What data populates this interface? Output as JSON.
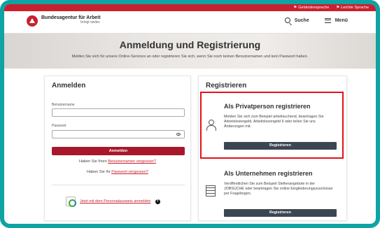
{
  "topbar": {
    "links": [
      "Gebärdensprache",
      "Leichte Sprache"
    ]
  },
  "header": {
    "brand_name": "Bundesagentur für Arbeit",
    "brand_tagline": "bringt weiter.",
    "search_label": "Suche",
    "menu_label": "Menü"
  },
  "hero": {
    "title": "Anmeldung und Registrierung",
    "subtitle": "Melden Sie sich für unsere Online-Services an oder registrieren Sie sich, wenn Sie noch keinen Benutzernamen und kein Passwort haben."
  },
  "login": {
    "title": "Anmelden",
    "username_label": "Benutzername",
    "username_value": "",
    "password_label": "Passwort",
    "password_value": "",
    "submit_label": "Anmelden",
    "forgot_user_prefix": "Haben Sie Ihren ",
    "forgot_user_link": "Benutzernamen vergessen?",
    "forgot_pw_prefix": "Haben Sie Ihr ",
    "forgot_pw_link": "Passwort vergessen?",
    "id_card_link": "Jetzt mit dem Personalausweis anmelden",
    "info_glyph": "?"
  },
  "register": {
    "title": "Registrieren",
    "private": {
      "title": "Als Privatperson registrieren",
      "text": "Melden Sie sich zum Beispiel arbeitsuchend, beantragen Sie Arbeitslosengeld, Arbeitslosengeld II oder teilen Sie uns Änderungen mit.",
      "button": "Registrieren"
    },
    "company": {
      "title": "Als Unternehmen registrieren",
      "text": "Veröffentlichen Sie zum Beispiel Stellenangebote in der JOBSUCHE oder beantragen Sie online Eingliederungszuschüsse per Fragebogen.",
      "button": "Registrieren"
    }
  },
  "colors": {
    "brand_red": "#c9202f",
    "button_red": "#a8182a",
    "button_dark": "#3c4652",
    "highlight_border": "#e2121c",
    "frame": "#0fa3a3"
  }
}
